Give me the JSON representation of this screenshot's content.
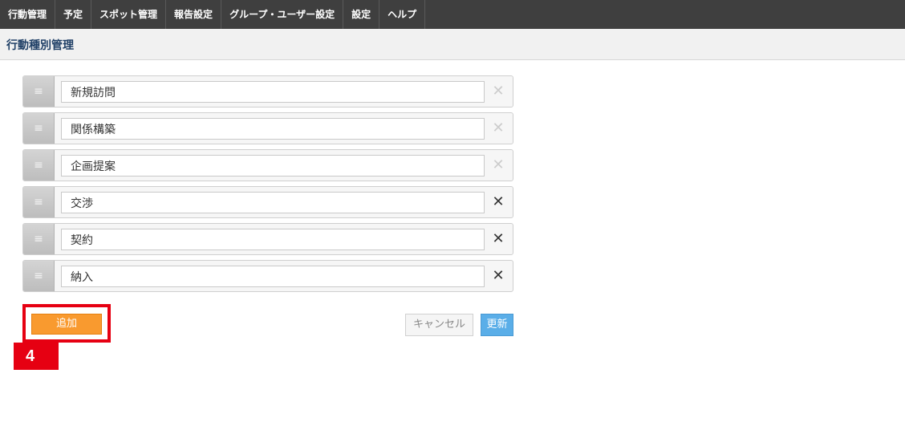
{
  "nav": {
    "items": [
      {
        "label": "行動管理"
      },
      {
        "label": "予定"
      },
      {
        "label": "スポット管理"
      },
      {
        "label": "報告設定"
      },
      {
        "label": "グループ・ユーザー設定"
      },
      {
        "label": "設定"
      },
      {
        "label": "ヘルプ"
      }
    ]
  },
  "page": {
    "title": "行動種別管理"
  },
  "list": {
    "handle_glyph": "≡",
    "delete_glyph": "✕",
    "items": [
      {
        "value": "新規訪問",
        "deletable": false
      },
      {
        "value": "関係構築",
        "deletable": false
      },
      {
        "value": "企画提案",
        "deletable": false
      },
      {
        "value": "交渉",
        "deletable": true
      },
      {
        "value": "契約",
        "deletable": true
      },
      {
        "value": "納入",
        "deletable": true
      }
    ]
  },
  "actions": {
    "add_label": "追加",
    "cancel_label": "キャンセル",
    "update_label": "更新"
  },
  "annotation": {
    "step": "4"
  },
  "colors": {
    "nav_bg": "#3f3f3f",
    "title": "#1f3f66",
    "add_button": "#f99a2f",
    "update_button": "#5aaee8",
    "highlight": "#e60012"
  }
}
